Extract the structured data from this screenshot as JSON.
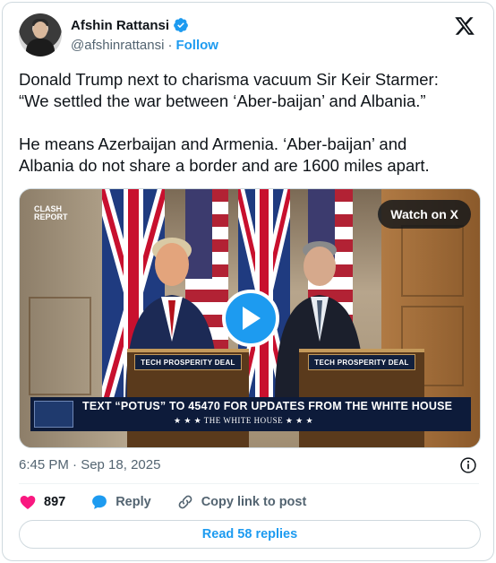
{
  "author": {
    "name": "Afshin Rattansi",
    "handle": "@afshinrattansi",
    "separator": "·",
    "follow_label": "Follow"
  },
  "tweet": {
    "text": "Donald Trump next to charisma vacuum Sir Keir Starmer:\n“We settled the war between ‘Aber-baijan’ and Albania.”\n\nHe means Azerbaijan and Armenia. ‘Aber-baijan’ and\nAlbania do not share a border and are 1600 miles apart.",
    "timestamp": "6:45 PM · Sep 18, 2025"
  },
  "media": {
    "source_logo_line1": "CLASH",
    "source_logo_line2": "REPORT",
    "watch_label": "Watch on X",
    "podium_left_sign": "TECH PROSPERITY DEAL",
    "podium_right_sign": "TECH PROSPERITY DEAL",
    "banner_text": "TEXT “POTUS” TO 45470 FOR UPDATES FROM THE WHITE HOUSE",
    "banner_sub": "★ ★ ★  THE WHITE HOUSE  ★ ★ ★"
  },
  "actions": {
    "like_count": "897",
    "reply_label": "Reply",
    "copy_link_label": "Copy link to post",
    "read_replies_label": "Read 58 replies"
  },
  "colors": {
    "accent": "#1d9bf0",
    "like": "#f91880",
    "muted": "#536471"
  },
  "icons": [
    "verified-badge-icon",
    "x-logo-icon",
    "info-icon",
    "heart-icon",
    "reply-bubble-icon",
    "link-icon",
    "play-icon"
  ]
}
